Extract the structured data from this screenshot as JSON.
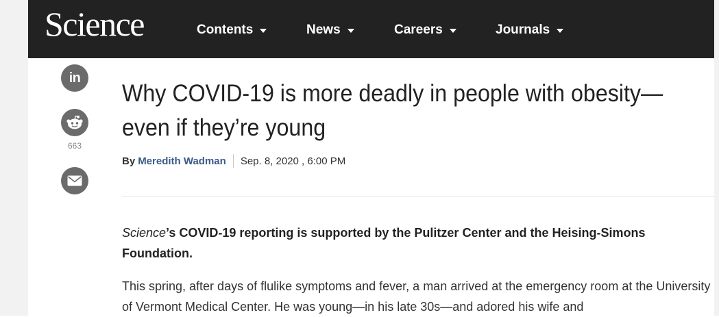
{
  "header": {
    "logo_text": "Science",
    "nav": [
      {
        "label": "Contents"
      },
      {
        "label": "News"
      },
      {
        "label": "Careers"
      },
      {
        "label": "Journals"
      }
    ]
  },
  "share": {
    "linkedin_label": "in",
    "reddit_count": "663"
  },
  "article": {
    "headline": "Why COVID-19 is more deadly in people with obesity—even if they’re young",
    "byline_prefix": "By",
    "author": "Meredith Wadman",
    "date": "Sep. 8, 2020 , 6:00 PM",
    "support_note_italic": "Science",
    "support_note_rest": "’s COVID-19 reporting is supported by the Pulitzer Center and the Heising-Simons Foundation.",
    "body_paragraph": "This spring, after days of flulike symptoms and fever, a man arrived at the emergency room at the University of Vermont Medical Center. He was young—in his late 30s—and adored his wife and"
  },
  "colors": {
    "topbar": "#222222",
    "author_link": "#3b5b87",
    "share_icon_bg": "#6b6b6b"
  }
}
